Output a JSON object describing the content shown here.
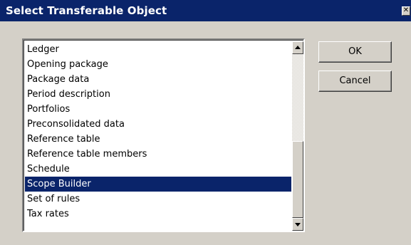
{
  "window": {
    "title": "Select Transferable Object",
    "close_glyph": "✕"
  },
  "list": {
    "items": [
      "Ledger",
      "Opening package",
      "Package data",
      "Period description",
      "Portfolios",
      "Preconsolidated data",
      "Reference table",
      "Reference table members",
      "Schedule",
      "Scope Builder",
      "Set of rules",
      "Tax rates"
    ],
    "selected_item": "Scope Builder"
  },
  "buttons": {
    "ok_label": "OK",
    "cancel_label": "Cancel"
  },
  "icons": {
    "close": "close-icon",
    "scroll_up": "arrow-up-icon",
    "scroll_down": "arrow-down-icon"
  },
  "colors": {
    "titlebar": "#0a246a",
    "selection": "#0a246a",
    "face": "#d4d0c8"
  }
}
